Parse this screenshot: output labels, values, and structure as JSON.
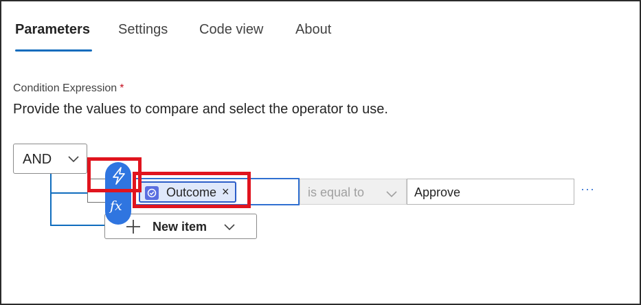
{
  "tabs": [
    {
      "label": "Parameters",
      "active": true
    },
    {
      "label": "Settings",
      "active": false
    },
    {
      "label": "Code view",
      "active": false
    },
    {
      "label": "About",
      "active": false
    }
  ],
  "condition": {
    "label": "Condition Expression",
    "required_mark": "*",
    "description": "Provide the values to compare and select the operator to use.",
    "group_operator": "AND",
    "row": {
      "left_token": {
        "text": "Outcome",
        "remove": "×",
        "icon": "approval-connector-icon"
      },
      "operator": "is equal to",
      "right_value": "Approve",
      "more": "···"
    },
    "new_item_label": "New item"
  },
  "insert_menu": {
    "dynamic_content_icon": "lightning-bolt-icon",
    "expression_label": "fx"
  },
  "colors": {
    "accent": "#0f6cbd",
    "token_bg": "#dfe8fb",
    "pill_bg": "#2f75e0",
    "highlight": "#e0141e",
    "required": "#c50f1f"
  }
}
